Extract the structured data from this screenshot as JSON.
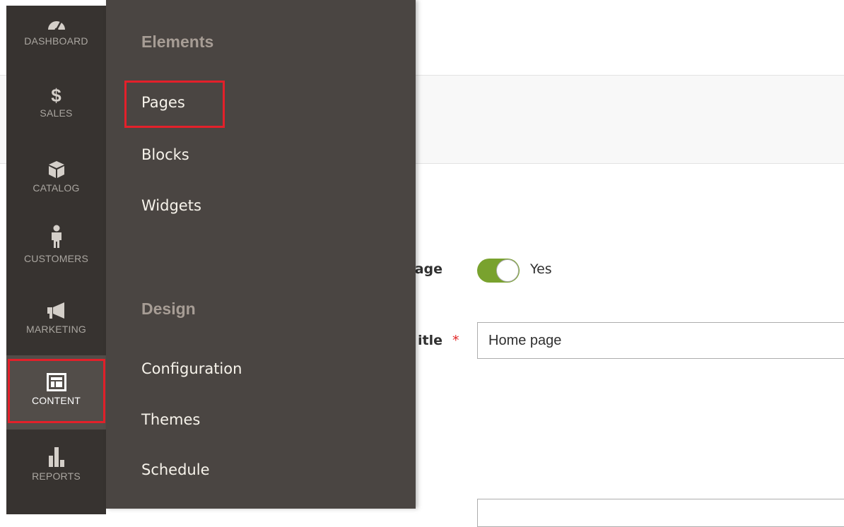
{
  "sidebar": {
    "items": [
      {
        "label": "DASHBOARD",
        "icon": "dashboard-gauge-icon"
      },
      {
        "label": "SALES",
        "icon": "dollar-icon"
      },
      {
        "label": "CATALOG",
        "icon": "box-icon"
      },
      {
        "label": "CUSTOMERS",
        "icon": "person-icon"
      },
      {
        "label": "MARKETING",
        "icon": "megaphone-icon"
      },
      {
        "label": "CONTENT",
        "icon": "layout-icon",
        "active": true
      },
      {
        "label": "REPORTS",
        "icon": "bar-chart-icon"
      }
    ]
  },
  "flyout": {
    "sections": [
      {
        "title": "Elements",
        "links": [
          "Pages",
          "Blocks",
          "Widgets"
        ]
      },
      {
        "title": "Design",
        "links": [
          "Configuration",
          "Themes",
          "Schedule"
        ]
      }
    ]
  },
  "form": {
    "enable_label_fragment": "age",
    "enable_value": "Yes",
    "title_label_fragment": "itle",
    "required_marker": "*",
    "title_value": "Home page"
  },
  "colors": {
    "sidebar_bg": "#373330",
    "flyout_bg": "#4a4542",
    "toggle_on": "#79a22e",
    "highlight": "#e3202a"
  }
}
